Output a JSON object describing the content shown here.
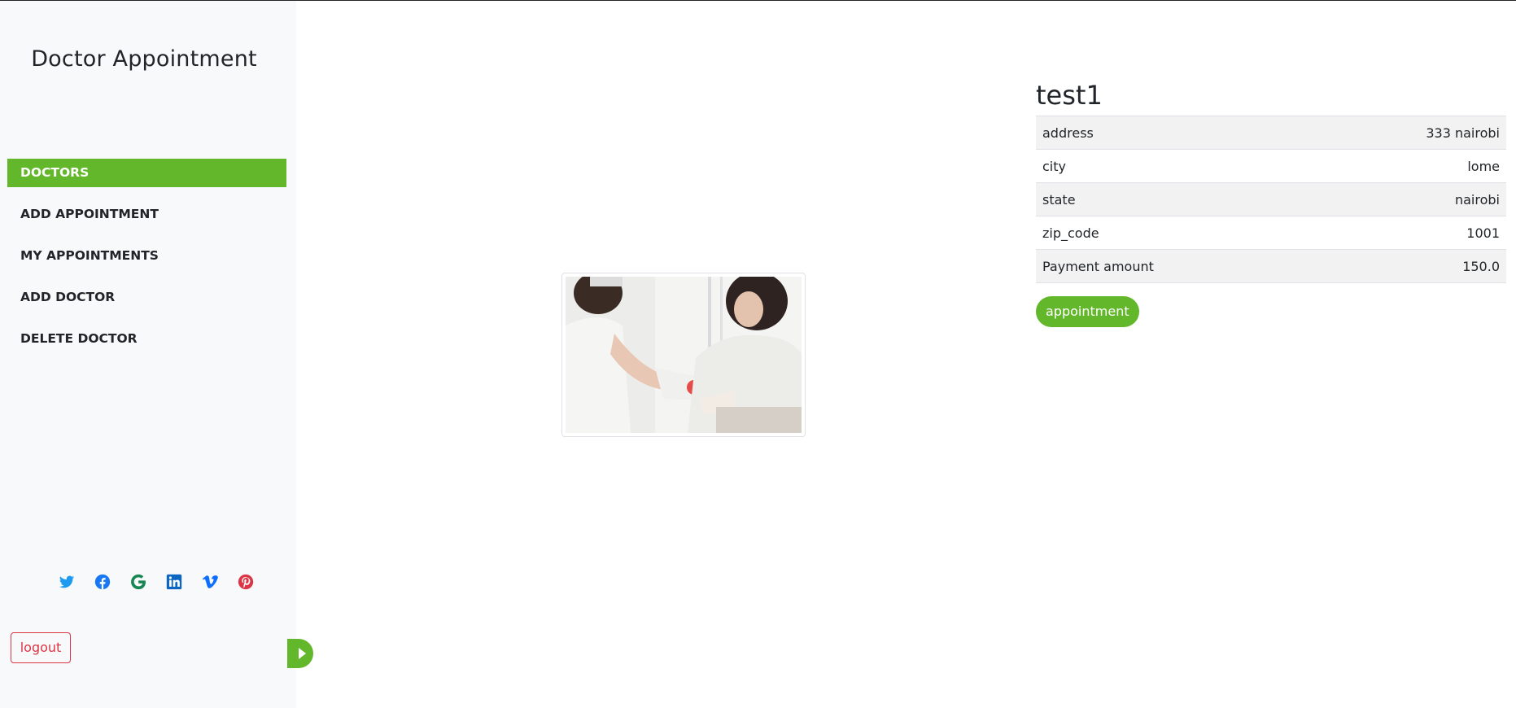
{
  "sidebar": {
    "brand": "Doctor Appointment",
    "nav": [
      {
        "label": "DOCTORS",
        "active": true
      },
      {
        "label": "ADD APPOINTMENT",
        "active": false
      },
      {
        "label": "MY APPOINTMENTS",
        "active": false
      },
      {
        "label": "ADD DOCTOR",
        "active": false
      },
      {
        "label": "DELETE DOCTOR",
        "active": false
      }
    ],
    "socials": [
      "twitter-icon",
      "facebook-icon",
      "google-icon",
      "linkedin-icon",
      "vimeo-icon",
      "pinterest-icon"
    ],
    "logout_label": "logout"
  },
  "doctor": {
    "name": "test1",
    "photo_icon": "doctor-with-child-patient-photo",
    "details": [
      {
        "key": "address",
        "value": "333 nairobi"
      },
      {
        "key": "city",
        "value": "lome"
      },
      {
        "key": "state",
        "value": "nairobi"
      },
      {
        "key": "zip_code",
        "value": "1001"
      },
      {
        "key": "Payment amount",
        "value": "150.0"
      }
    ],
    "appointment_label": "appointment"
  },
  "colors": {
    "accent": "#62b72a",
    "danger": "#dc3545",
    "sidebar_bg": "#f8f9fa",
    "twitter": "#1d9bf0",
    "facebook": "#1877f2",
    "google": "#198754",
    "linkedin": "#0a66c2",
    "vimeo": "#0d6efd",
    "pinterest": "#dc3545"
  }
}
